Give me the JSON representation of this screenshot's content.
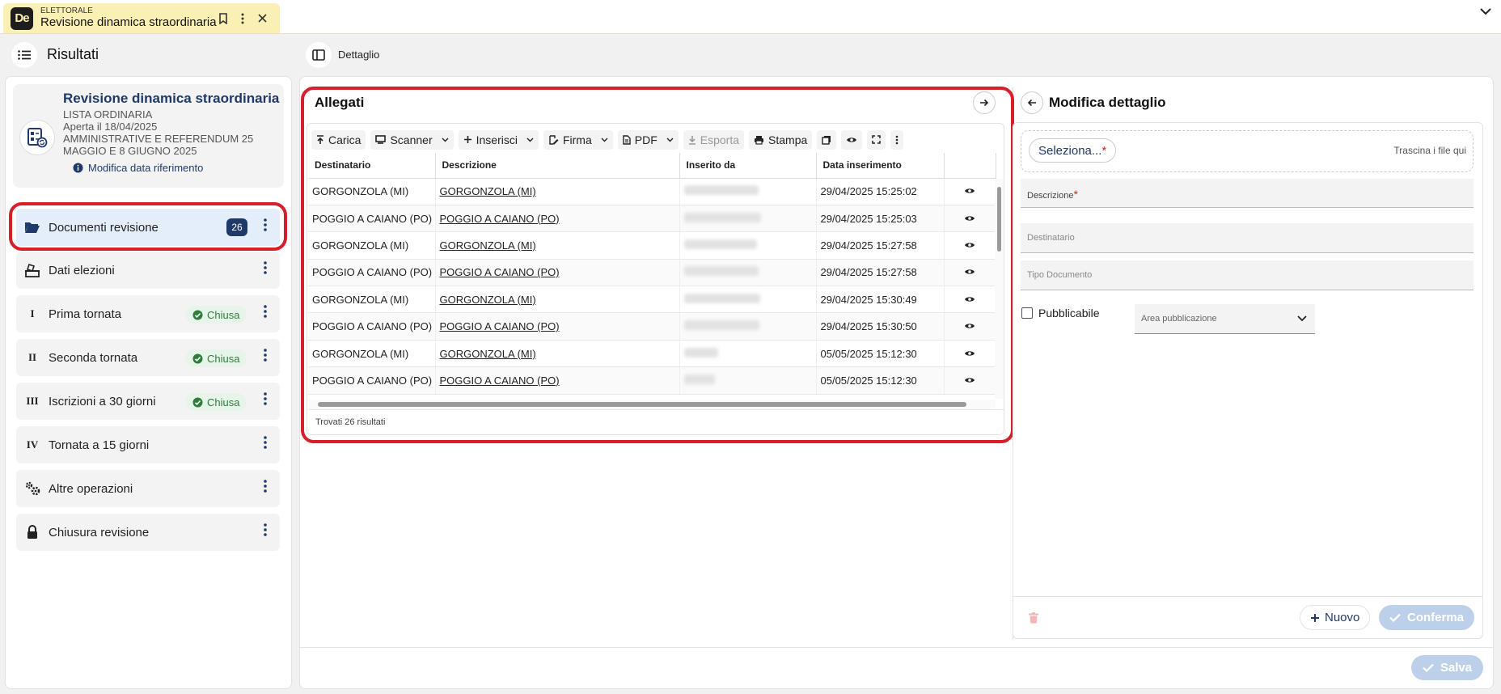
{
  "app_tab": {
    "category": "ELETTORALE",
    "title": "Revisione dinamica straordinaria",
    "logo": "De"
  },
  "left": {
    "header": "Risultati",
    "revision": {
      "title": "Revisione dinamica straordinaria",
      "list_type": "LISTA ORDINARIA",
      "opened": "Aperta il 18/04/2025",
      "election_line1": "AMMINISTRATIVE E REFERENDUM 25",
      "election_line2": "MAGGIO E 8 GIUGNO 2025",
      "modify_link": "Modifica data riferimento"
    },
    "menu": [
      {
        "label": "Documenti revisione",
        "badge": "26",
        "icon": "folder-open-icon"
      },
      {
        "label": "Dati elezioni",
        "icon": "ballot-box-icon"
      },
      {
        "label": "Prima tornata",
        "roman": "I",
        "status": "Chiusa"
      },
      {
        "label": "Seconda tornata",
        "roman": "II",
        "status": "Chiusa"
      },
      {
        "label": "Iscrizioni a 30 giorni",
        "roman": "III",
        "status": "Chiusa"
      },
      {
        "label": "Tornata a 15 giorni",
        "roman": "IV"
      },
      {
        "label": "Altre operazioni",
        "icon": "gears-icon"
      },
      {
        "label": "Chiusura revisione",
        "icon": "lock-icon"
      }
    ]
  },
  "right_header": "Dettaglio",
  "allegati": {
    "title": "Allegati",
    "toolbar": {
      "carica": "Carica",
      "scanner": "Scanner",
      "inserisci": "Inserisci",
      "firma": "Firma",
      "pdf": "PDF",
      "esporta": "Esporta",
      "stampa": "Stampa"
    },
    "columns": [
      "Destinatario",
      "Descrizione",
      "Inserito da",
      "Data inserimento"
    ],
    "rows": [
      {
        "dest": "GORGONZOLA (MI)",
        "desc": "GORGONZOLA (MI)",
        "date": "29/04/2025 15:25:02"
      },
      {
        "dest": "POGGIO A CAIANO (PO)",
        "desc": "POGGIO A CAIANO (PO)",
        "date": "29/04/2025 15:25:03"
      },
      {
        "dest": "GORGONZOLA (MI)",
        "desc": "GORGONZOLA (MI)",
        "date": "29/04/2025 15:27:58"
      },
      {
        "dest": "POGGIO A CAIANO (PO)",
        "desc": "POGGIO A CAIANO (PO)",
        "date": "29/04/2025 15:27:58"
      },
      {
        "dest": "GORGONZOLA (MI)",
        "desc": "GORGONZOLA (MI)",
        "date": "29/04/2025 15:30:49"
      },
      {
        "dest": "POGGIO A CAIANO (PO)",
        "desc": "POGGIO A CAIANO (PO)",
        "date": "29/04/2025 15:30:50"
      },
      {
        "dest": "GORGONZOLA (MI)",
        "desc": "GORGONZOLA (MI)",
        "date": "05/05/2025 15:12:30"
      },
      {
        "dest": "POGGIO A CAIANO (PO)",
        "desc": "POGGIO A CAIANO (PO)",
        "date": "05/05/2025 15:12:30"
      }
    ],
    "footer": "Trovati 26 risultati"
  },
  "detail": {
    "title": "Modifica dettaglio",
    "select_button": "Seleziona...",
    "required_mark": "*",
    "drop_hint": "Trascina i file qui",
    "descrizione_label": "Descrizione",
    "destinatario_label": "Destinatario",
    "tipo_label": "Tipo Documento",
    "pubblicabile_label": "Pubblicabile",
    "area_label": "Area pubblicazione",
    "nuovo": "Nuovo",
    "conferma": "Conferma"
  },
  "salva": "Salva",
  "colors": {
    "primary": "#1f3a6a",
    "highlight": "#d81e2a",
    "tab_bg": "#fbf0b4",
    "success": "#2e7d3a"
  }
}
